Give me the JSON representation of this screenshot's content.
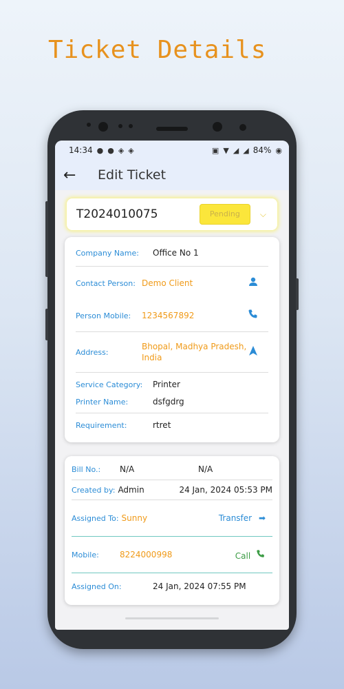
{
  "promo": {
    "title": "Ticket Details"
  },
  "status_bar": {
    "time": "14:34",
    "battery": "84%",
    "left_icons": [
      "chat-bubble-icon",
      "facebook-icon",
      "sync-icon",
      "sync-icon"
    ],
    "right_icons": [
      "volte-icon",
      "wifi-icon",
      "signal-icon",
      "signal-icon",
      "battery-icon"
    ]
  },
  "app_bar": {
    "title": "Edit Ticket"
  },
  "ticket": {
    "id": "T2024010075",
    "status": "Pending"
  },
  "details": {
    "company_label": "Company Name:",
    "company_value": "Office No 1",
    "contact_label": "Contact Person:",
    "contact_value": "Demo Client",
    "mobile_label": "Person Mobile:",
    "mobile_value": "1234567892",
    "address_label": "Address:",
    "address_line1": "Bhopal, Madhya Pradesh,",
    "address_line2": "India",
    "service_label": "Service Category:",
    "service_value": "Printer",
    "printer_label": "Printer  Name:",
    "printer_value": "dsfgdrg",
    "requirement_label": "Requirement:",
    "requirement_value": "rtret"
  },
  "assignment": {
    "bill_label": "Bill No.:",
    "bill_value1": "N/A",
    "bill_value2": "N/A",
    "created_label": "Created by:",
    "created_by": "Admin",
    "created_on": "24 Jan, 2024 05:53 PM",
    "assigned_label": "Assigned To:",
    "assigned_to": "Sunny",
    "transfer_label": "Transfer",
    "mobile_label": "Mobile:",
    "mobile_value": "8224000998",
    "call_label": "Call",
    "assigned_on_label": "Assigned On:",
    "assigned_on_value": "24 Jan, 2024 07:55 PM"
  },
  "colors": {
    "accent_blue": "#2b8cd6",
    "accent_orange": "#f09a18",
    "pending_yellow": "#fbe63b",
    "call_green": "#3c9c45"
  }
}
